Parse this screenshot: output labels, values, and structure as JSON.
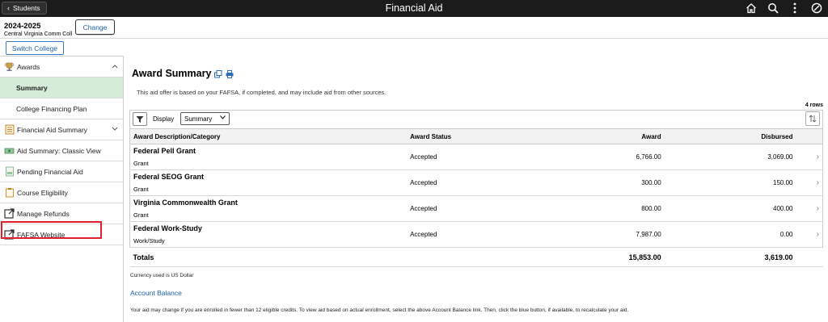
{
  "header": {
    "back_label": "Students",
    "title": "Financial Aid",
    "icons": [
      "home-icon",
      "search-icon",
      "more-vertical-icon",
      "circle-slash-icon"
    ]
  },
  "term": {
    "year": "2024-2025",
    "college": "Central Virginia Comm Coll",
    "change_label": "Change",
    "switch_label": "Switch College"
  },
  "sidebar": {
    "items": [
      {
        "label": "Awards",
        "icon": "trophy-icon",
        "expanded": true
      },
      {
        "label": "Summary",
        "active": true
      },
      {
        "label": "College Financing Plan"
      },
      {
        "label": "Financial Aid Summary",
        "icon": "checklist-icon"
      },
      {
        "label": "Aid Summary: Classic View",
        "icon": "money-icon"
      },
      {
        "label": "Pending Financial Aid",
        "icon": "pending-aid-icon"
      },
      {
        "label": "Course Eligibility",
        "icon": "clipboard-icon"
      },
      {
        "label": "Manage Refunds",
        "icon": "external-link-icon"
      },
      {
        "label": "FAFSA Website",
        "icon": "external-link-icon"
      }
    ]
  },
  "main": {
    "title": "Award Summary",
    "intro": "This aid offer is based on your FAFSA, if completed, and may include aid from other sources.",
    "rows_count": "4 rows",
    "display_label": "Display",
    "display_value": "Summary",
    "columns": [
      "Award Description/Category",
      "Award Status",
      "Award",
      "Disbursed"
    ],
    "rows": [
      {
        "name": "Federal Pell Grant",
        "category": "Grant",
        "status": "Accepted",
        "award": "6,766.00",
        "disbursed": "3,069.00"
      },
      {
        "name": "Federal SEOG Grant",
        "category": "Grant",
        "status": "Accepted",
        "award": "300.00",
        "disbursed": "150.00"
      },
      {
        "name": "Virginia Commonwealth Grant",
        "category": "Grant",
        "status": "Accepted",
        "award": "800.00",
        "disbursed": "400.00"
      },
      {
        "name": "Federal Work-Study",
        "category": "Work/Study",
        "status": "Accepted",
        "award": "7,987.00",
        "disbursed": "0.00"
      }
    ],
    "totals": {
      "label": "Totals",
      "award": "15,853.00",
      "disbursed": "3,619.00"
    },
    "currency_note": "Currency used is US Dollar",
    "account_balance_link": "Account Balance",
    "footnote": "Your aid may change if you are enrolled in fewer than 12 eligible credits. To view aid based on actual enrollment, select the above Account Balance link. Then, click the blue button, if available, to recalculate your aid."
  }
}
